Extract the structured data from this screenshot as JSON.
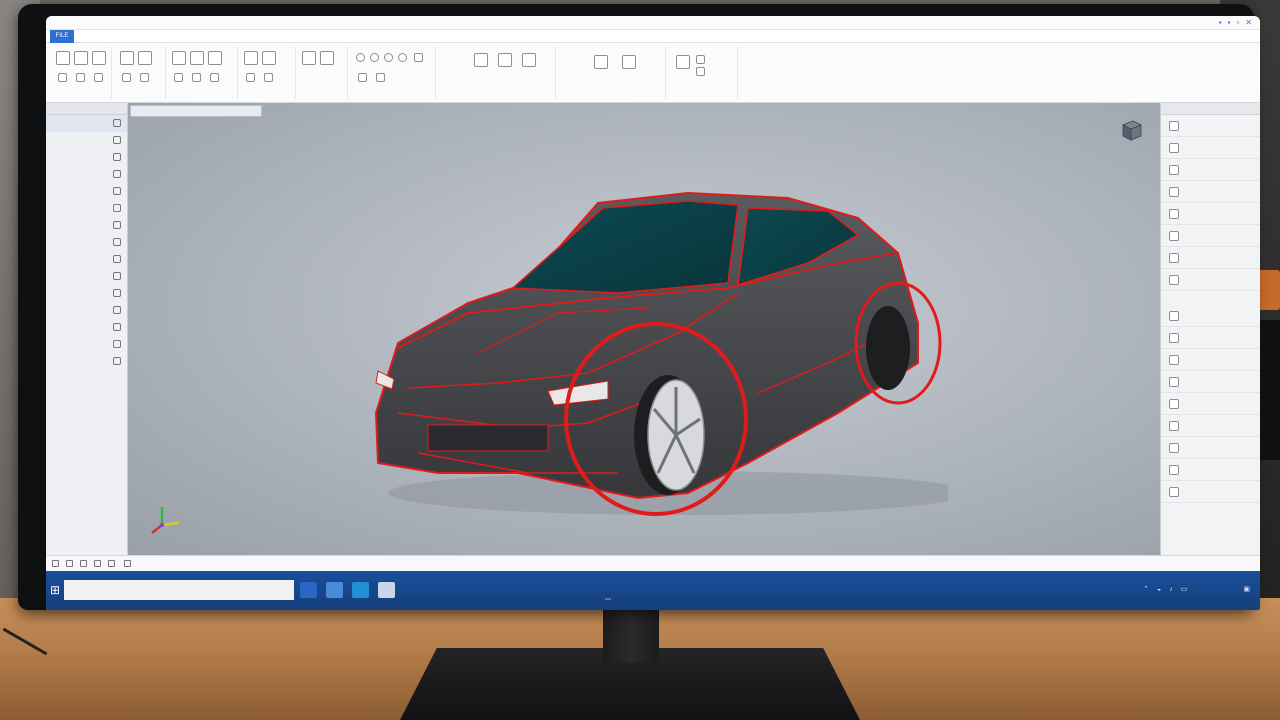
{
  "window": {
    "title": "",
    "controls": [
      "minimize-icon",
      "restore-icon",
      "maximize-icon",
      "close-icon"
    ]
  },
  "ribbon": {
    "file_tab": "FILE",
    "tabs": [
      "",
      "",
      "",
      "",
      "",
      "",
      "",
      "",
      "",
      "",
      "",
      ""
    ],
    "groups": [
      "",
      "",
      "",
      "",
      "",
      "",
      "",
      "",
      ""
    ]
  },
  "browser": {
    "header": "",
    "items": [
      "",
      "",
      "",
      "",
      "",
      "",
      "",
      "",
      "",
      "",
      "",
      "",
      "",
      "",
      ""
    ]
  },
  "viewport": {
    "document_tab": "",
    "model": "car-body",
    "highlight_color": "#e11a1a"
  },
  "properties": {
    "header": "",
    "items": [
      "",
      "",
      "",
      "",
      "",
      "",
      "",
      "",
      "",
      "",
      "",
      "",
      "",
      "",
      "",
      "",
      ""
    ]
  },
  "taskbar": {
    "search_placeholder": "",
    "clock_time": "",
    "clock_date": ""
  },
  "colors": {
    "accent": "#2d6fd2",
    "taskbar": "#1a4f9a",
    "highlight": "#e11a1a",
    "car_body": "#4a4b4e"
  }
}
